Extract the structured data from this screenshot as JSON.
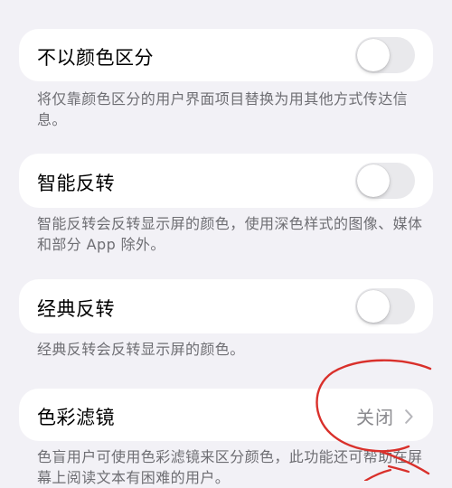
{
  "settings": [
    {
      "label": "不以颜色区分",
      "control": "toggle",
      "state": "off",
      "footer": "将仅靠颜色区分的用户界面项目替换为用其他方式传达信息。"
    },
    {
      "label": "智能反转",
      "control": "toggle",
      "state": "off",
      "footer": "智能反转会反转显示屏的颜色，使用深色样式的图像、媒体和部分 App 除外。"
    },
    {
      "label": "经典反转",
      "control": "toggle",
      "state": "off",
      "footer": "经典反转会反转显示屏的颜色。"
    },
    {
      "label": "色彩滤镜",
      "control": "disclosure",
      "value": "关闭",
      "footer": "色盲用户可使用色彩滤镜来区分颜色，此功能还可帮助在屏幕上阅读文本有困难的用户。"
    }
  ],
  "colors": {
    "background": "#f2f1f6",
    "cell": "#ffffff",
    "toggle_off": "#e9e9ec",
    "secondary_text": "#6e6e73",
    "annotation": "#d9302b"
  },
  "icons": {
    "disclosure": "chevron-right-icon"
  }
}
